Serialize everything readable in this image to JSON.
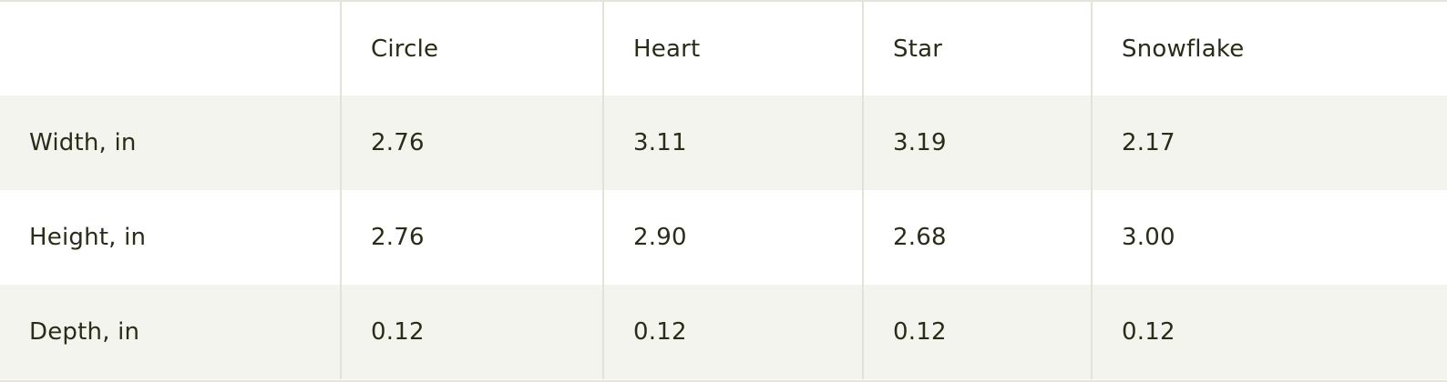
{
  "table": {
    "columns": [
      "",
      "Circle",
      "Heart",
      "Star",
      "Snowflake"
    ],
    "rows": [
      {
        "label": "Width, in",
        "values": [
          "2.76",
          "3.11",
          "3.19",
          "2.17"
        ]
      },
      {
        "label": "Height, in",
        "values": [
          "2.76",
          "2.90",
          "2.68",
          "3.00"
        ]
      },
      {
        "label": "Depth, in",
        "values": [
          "0.12",
          "0.12",
          "0.12",
          "0.12"
        ]
      }
    ]
  },
  "colors": {
    "text": "#2b2c17",
    "alt_row_bg": "#f4f4ef",
    "divider": "#e2e2d9"
  }
}
